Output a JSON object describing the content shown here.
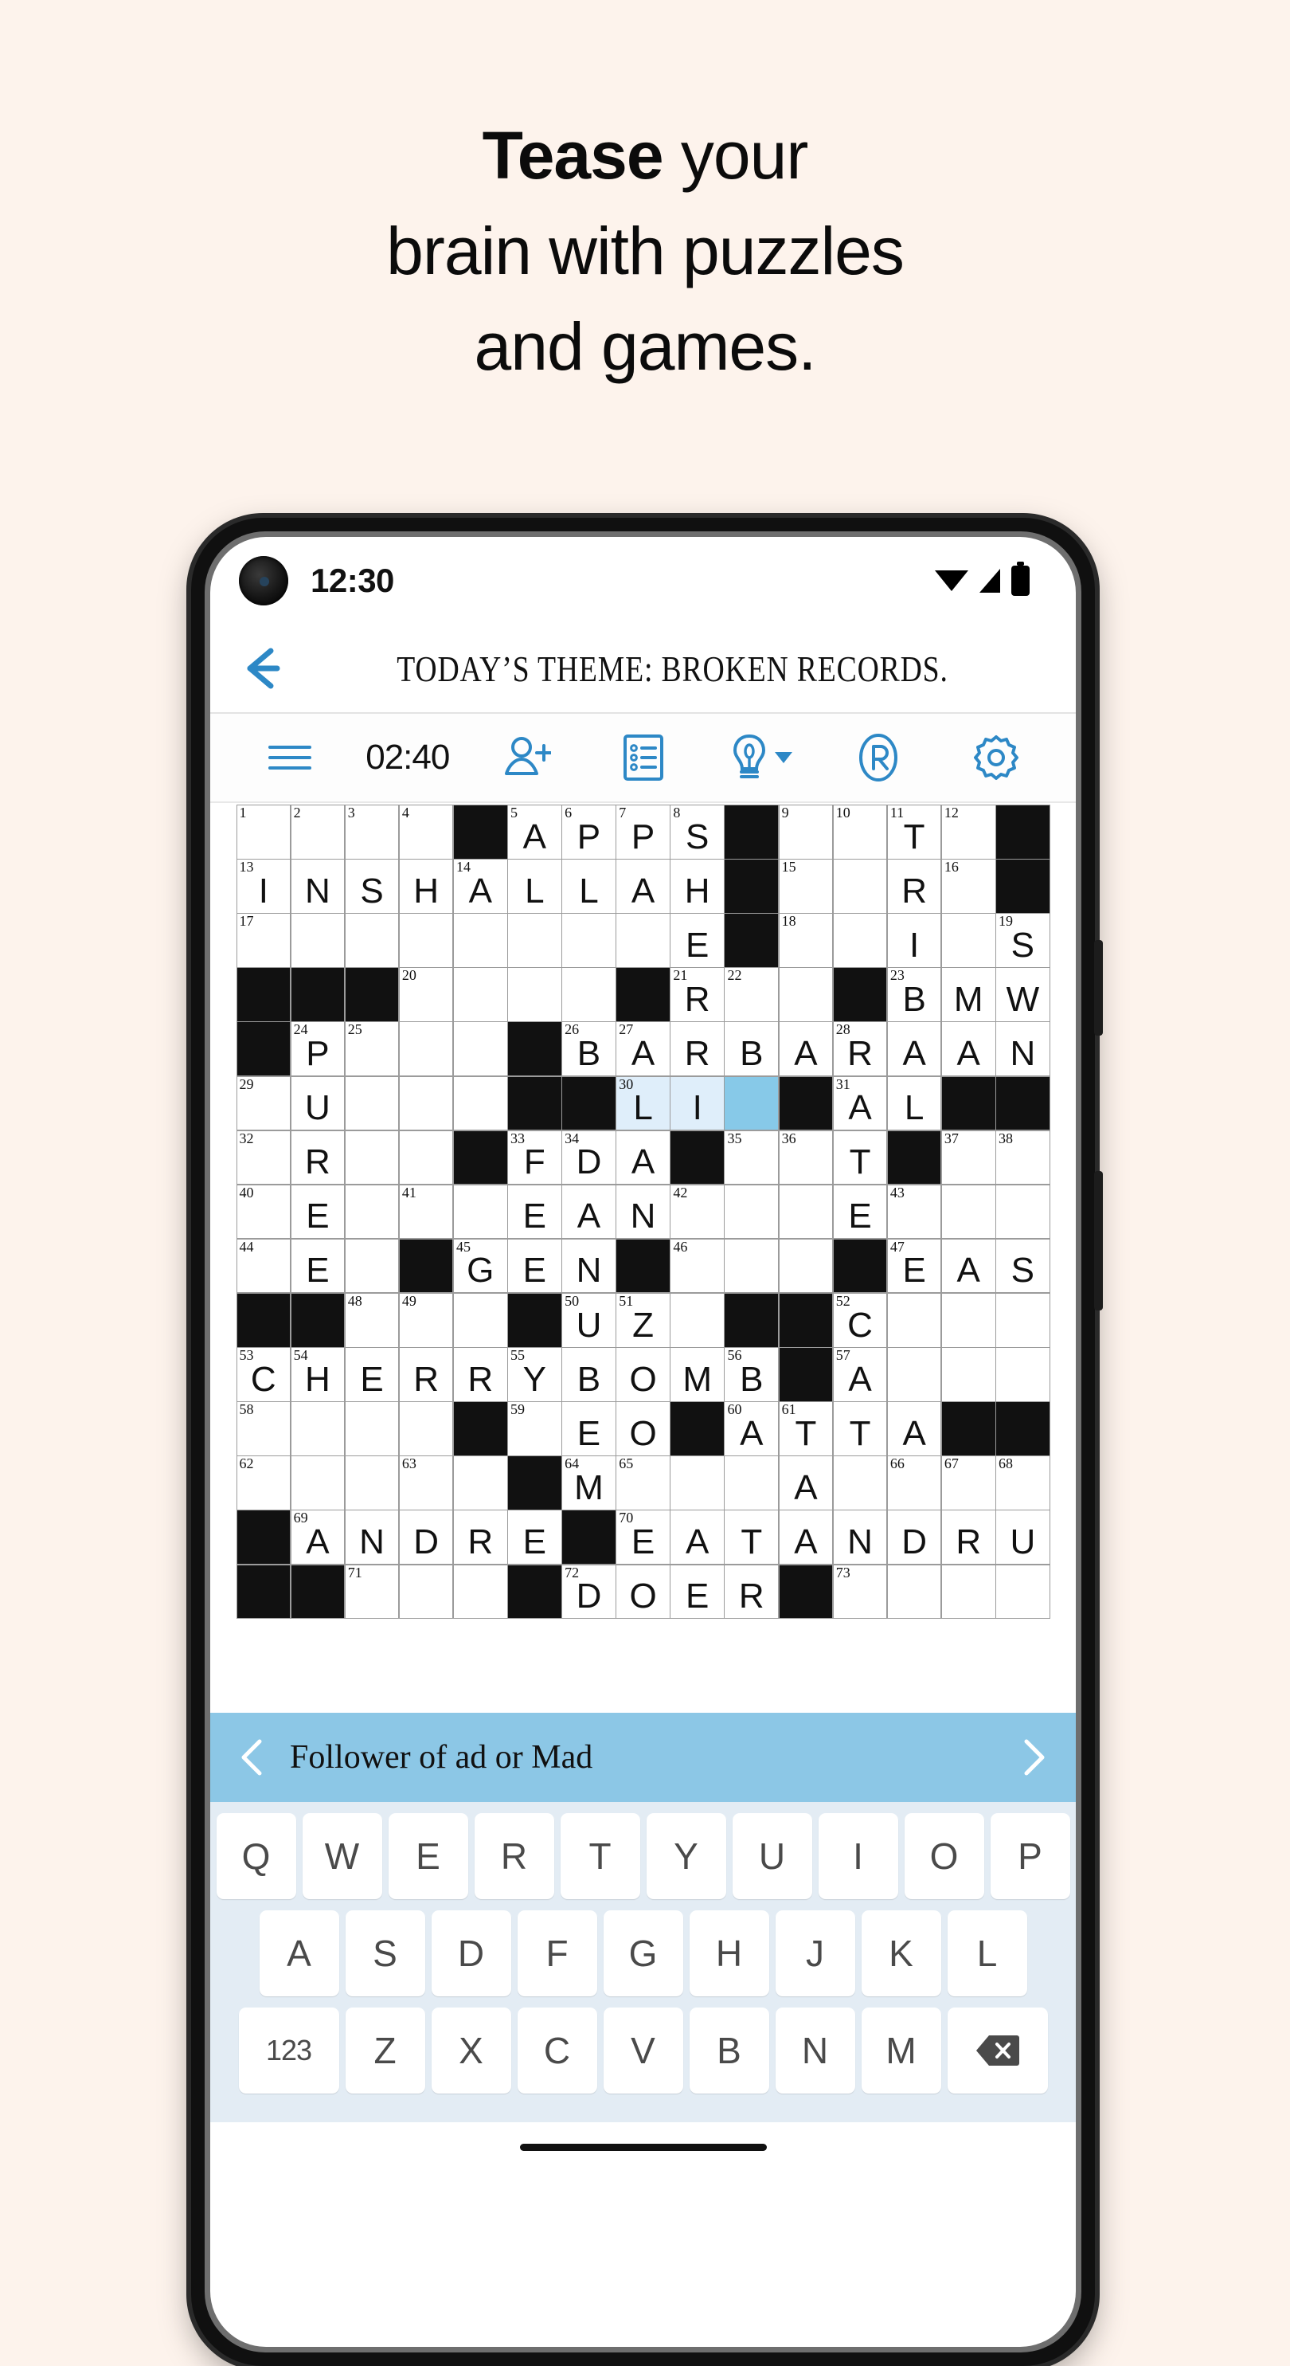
{
  "promo": {
    "headline_bold": "Tease",
    "headline_rest": " your",
    "headline_line2": "brain with puzzles",
    "headline_line3": "and games.",
    "background_color": "#fdf3ec"
  },
  "status_bar": {
    "time": "12:30",
    "icons": [
      "wifi-icon",
      "signal-icon",
      "battery-icon"
    ]
  },
  "title_bar": {
    "back_icon": "back-arrow-icon",
    "theme": "TODAY’S THEME: BROKEN RECORDS."
  },
  "toolbar": {
    "menu_icon": "hamburger-menu-icon",
    "timer": "02:40",
    "items": [
      {
        "icon": "add-person-icon",
        "label": "Add player"
      },
      {
        "icon": "clue-list-icon",
        "label": "Clue list"
      },
      {
        "icon": "hint-bulb-icon",
        "label": "Hints"
      },
      {
        "icon": "rebus-circled-r-icon",
        "label": "Rebus"
      },
      {
        "icon": "settings-gear-icon",
        "label": "Settings"
      }
    ],
    "accent_color": "#2d88c6"
  },
  "clue_bar": {
    "prev_icon": "chevron-left-icon",
    "next_icon": "chevron-right-icon",
    "clue": "Follower of ad or Mad",
    "background_color": "#8cc7e6"
  },
  "keyboard": {
    "row1": [
      "Q",
      "W",
      "E",
      "R",
      "T",
      "Y",
      "U",
      "I",
      "O",
      "P"
    ],
    "row2": [
      "A",
      "S",
      "D",
      "F",
      "G",
      "H",
      "J",
      "K",
      "L"
    ],
    "row3_prefix": "123",
    "row3": [
      "Z",
      "X",
      "C",
      "V",
      "B",
      "N",
      "M"
    ],
    "backspace_icon": "backspace-icon",
    "background_color": "#e3ecf4"
  },
  "crossword": {
    "rows": 15,
    "cols": 15,
    "highlight_color": "#dfeefa",
    "cursor_color": "#87c9e8",
    "grid": [
      [
        {
          "n": "1"
        },
        {
          "n": "2"
        },
        {
          "n": "3"
        },
        {
          "n": "4"
        },
        {
          "b": true
        },
        {
          "n": "5",
          "l": "A"
        },
        {
          "n": "6",
          "l": "P"
        },
        {
          "n": "7",
          "l": "P"
        },
        {
          "n": "8",
          "l": "S"
        },
        {
          "b": true
        },
        {
          "n": "9"
        },
        {
          "n": "10"
        },
        {
          "n": "11",
          "l": "T"
        },
        {
          "n": "12"
        },
        {
          "b": true
        }
      ],
      [
        {
          "n": "13",
          "l": "I"
        },
        {
          "l": "N"
        },
        {
          "l": "S"
        },
        {
          "l": "H"
        },
        {
          "n": "14",
          "l": "A"
        },
        {
          "l": "L"
        },
        {
          "l": "L"
        },
        {
          "l": "A"
        },
        {
          "l": "H"
        },
        {
          "b": true
        },
        {
          "n": "15"
        },
        {},
        {
          "l": "R"
        },
        {
          "n": "16"
        },
        {
          "b": true
        }
      ],
      [
        {
          "n": "17"
        },
        {},
        {},
        {},
        {},
        {},
        {},
        {},
        {
          "l": "E"
        },
        {
          "b": true
        },
        {
          "n": "18"
        },
        {},
        {
          "l": "I"
        },
        {},
        {
          "n": "19",
          "l": "S"
        }
      ],
      [
        {
          "b": true
        },
        {
          "b": true
        },
        {
          "b": true
        },
        {
          "n": "20"
        },
        {},
        {},
        {},
        {
          "b": true
        },
        {
          "n": "21",
          "l": "R"
        },
        {
          "n": "22"
        },
        {},
        {
          "b": true
        },
        {
          "n": "23",
          "l": "B"
        },
        {
          "l": "M"
        },
        {
          "l": "W"
        }
      ],
      [
        {
          "b": true
        },
        {
          "n": "24",
          "l": "P"
        },
        {
          "n": "25"
        },
        {},
        {},
        {
          "b": true
        },
        {
          "n": "26",
          "l": "B"
        },
        {
          "n": "27",
          "l": "A"
        },
        {
          "l": "R"
        },
        {
          "l": "B"
        },
        {
          "l": "A"
        },
        {
          "n": "28",
          "l": "R"
        },
        {
          "l": "A"
        },
        {
          "l": "A"
        },
        {
          "l": "N"
        }
      ],
      [
        {
          "n": "29"
        },
        {
          "l": "U"
        },
        {},
        {},
        {},
        {
          "b": true
        },
        {
          "b": true
        },
        {
          "n": "30",
          "l": "L",
          "h": true
        },
        {
          "l": "I",
          "h": true
        },
        {
          "c": true
        },
        {
          "b": true
        },
        {
          "n": "31",
          "l": "A"
        },
        {
          "l": "L"
        },
        {
          "b": true
        },
        {
          "b": true
        }
      ],
      [
        {
          "n": "32"
        },
        {
          "l": "R"
        },
        {},
        {},
        {
          "b": true
        },
        {
          "n": "33",
          "l": "F"
        },
        {
          "n": "34",
          "l": "D"
        },
        {
          "l": "A"
        },
        {
          "b": true
        },
        {
          "n": "35"
        },
        {
          "n": "36"
        },
        {
          "l": "T"
        },
        {
          "b": true
        },
        {
          "n": "37"
        },
        {
          "n": "38"
        }
      ],
      [
        {
          "n": "40"
        },
        {
          "l": "E"
        },
        {},
        {
          "n": "41"
        },
        {},
        {
          "l": "E"
        },
        {
          "l": "A"
        },
        {
          "l": "N"
        },
        {
          "n": "42"
        },
        {},
        {},
        {
          "l": "E"
        },
        {
          "n": "43"
        },
        {},
        {}
      ],
      [
        {
          "n": "44"
        },
        {
          "l": "E"
        },
        {},
        {
          "b": true
        },
        {
          "n": "45",
          "l": "G"
        },
        {
          "l": "E"
        },
        {
          "l": "N"
        },
        {
          "b": true
        },
        {
          "n": "46"
        },
        {},
        {},
        {
          "b": true
        },
        {
          "n": "47",
          "l": "E"
        },
        {
          "l": "A"
        },
        {
          "l": "S"
        }
      ],
      [
        {
          "b": true
        },
        {
          "b": true
        },
        {
          "n": "48"
        },
        {
          "n": "49"
        },
        {},
        {
          "b": true
        },
        {
          "n": "50",
          "l": "U"
        },
        {
          "n": "51",
          "l": "Z"
        },
        {},
        {
          "b": true
        },
        {
          "b": true
        },
        {
          "n": "52",
          "l": "C"
        },
        {},
        {},
        {}
      ],
      [
        {
          "n": "53",
          "l": "C"
        },
        {
          "n": "54",
          "l": "H"
        },
        {
          "l": "E"
        },
        {
          "l": "R"
        },
        {
          "l": "R"
        },
        {
          "n": "55",
          "l": "Y"
        },
        {
          "l": "B"
        },
        {
          "l": "O"
        },
        {
          "l": "M"
        },
        {
          "n": "56",
          "l": "B"
        },
        {
          "b": true
        },
        {
          "n": "57",
          "l": "A"
        },
        {},
        {},
        {}
      ],
      [
        {
          "n": "58"
        },
        {},
        {},
        {},
        {
          "b": true
        },
        {
          "n": "59"
        },
        {
          "l": "E"
        },
        {
          "l": "O"
        },
        {
          "b": true
        },
        {
          "n": "60",
          "l": "A"
        },
        {
          "n": "61",
          "l": "T"
        },
        {
          "l": "T"
        },
        {
          "l": "A"
        },
        {
          "b": true
        },
        {
          "b": true
        }
      ],
      [
        {
          "n": "62"
        },
        {},
        {},
        {
          "n": "63"
        },
        {},
        {
          "b": true
        },
        {
          "n": "64",
          "l": "M"
        },
        {
          "n": "65"
        },
        {},
        {},
        {
          "l": "A"
        },
        {},
        {
          "n": "66"
        },
        {
          "n": "67"
        },
        {
          "n": "68"
        }
      ],
      [
        {
          "b": true
        },
        {
          "n": "69",
          "l": "A"
        },
        {
          "l": "N"
        },
        {
          "l": "D"
        },
        {
          "l": "R"
        },
        {
          "l": "E"
        },
        {
          "b": true
        },
        {
          "n": "70",
          "l": "E"
        },
        {
          "l": "A"
        },
        {
          "l": "T"
        },
        {
          "l": "A"
        },
        {
          "l": "N"
        },
        {
          "l": "D"
        },
        {
          "l": "R"
        },
        {
          "l": "U"
        }
      ],
      [
        {
          "b": true
        },
        {
          "b": true
        },
        {
          "n": "71"
        },
        {},
        {},
        {
          "b": true
        },
        {
          "n": "72",
          "l": "D"
        },
        {
          "l": "O"
        },
        {
          "l": "E"
        },
        {
          "l": "R"
        },
        {
          "b": true
        },
        {
          "n": "73"
        },
        {},
        {},
        {}
      ]
    ]
  }
}
